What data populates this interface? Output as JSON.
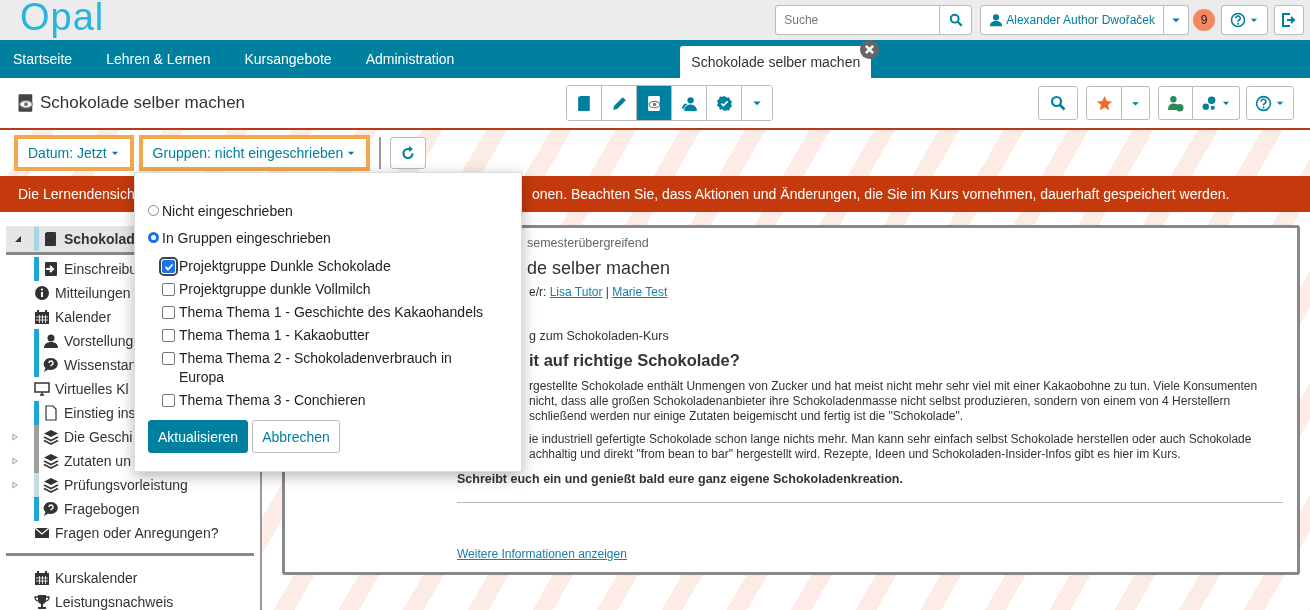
{
  "header": {
    "logo": "Opal",
    "search": {
      "placeholder": "Suche"
    },
    "user": "Alexander Author Dwořaček",
    "notifications": "9"
  },
  "nav": {
    "items": [
      {
        "label": "Startseite",
        "selected": false
      },
      {
        "label": "Lehren & Lernen",
        "selected": false
      },
      {
        "label": "Kursangebote",
        "selected": false
      },
      {
        "label": "Administration",
        "selected": false
      },
      {
        "label": "Schokolade selber machen",
        "selected": true
      }
    ]
  },
  "course": {
    "title": "Schokolade selber machen",
    "views": [
      {
        "kind": "book",
        "selected": false
      },
      {
        "kind": "pencil",
        "selected": false
      },
      {
        "kind": "eye-book",
        "selected": true
      },
      {
        "kind": "people",
        "selected": false
      },
      {
        "kind": "badge",
        "selected": false
      }
    ]
  },
  "filters": [
    {
      "label": "Datum: Jetzt"
    },
    {
      "label": "Gruppen: nicht eingeschrieben"
    }
  ],
  "banner": {
    "before": "Die Lernendensich",
    "after": "onen. Beachten Sie, dass Aktionen und Änderungen, die Sie im Kurs vornehmen, dauerhaft gespeichert werden."
  },
  "sidebar": {
    "items": [
      {
        "label": "Schokolad",
        "kind": "book",
        "selected": true,
        "expanded": true,
        "color": "#a9d4e4"
      },
      {
        "label": "Einschreibu",
        "kind": "enter",
        "selected": false,
        "color": "#1ba7d6"
      },
      {
        "label": "Mitteilungen",
        "kind": "info",
        "selected": false
      },
      {
        "label": "Kalender",
        "kind": "calendar",
        "selected": false
      },
      {
        "label": "Vorstellung",
        "kind": "person",
        "selected": false,
        "color": "#1ba7d6"
      },
      {
        "label": "Wissenstan",
        "kind": "question",
        "selected": false,
        "color": "#1ba7d6"
      },
      {
        "label": "Virtuelles Kl",
        "kind": "monitor",
        "selected": false
      },
      {
        "label": "Einstieg ins",
        "kind": "page",
        "selected": false,
        "color": "#1ba7d6"
      },
      {
        "label": "Die Geschi",
        "kind": "layers",
        "selected": false,
        "expanded": false,
        "color": "#9e9e9e"
      },
      {
        "label": "Zutaten un",
        "kind": "layers",
        "selected": false,
        "expanded": false,
        "color": "#9e9e9e"
      },
      {
        "label": "Prüfungsvorleistung",
        "kind": "layers",
        "selected": false,
        "expanded": false,
        "color": "#c6dce4"
      },
      {
        "label": "Fragebogen",
        "kind": "question",
        "selected": false,
        "color": "#1ba7d6"
      },
      {
        "label": "Fragen oder Anregungen?",
        "kind": "envelope",
        "selected": false
      }
    ],
    "footer_items": [
      {
        "label": "Kurskalender",
        "kind": "calendar"
      },
      {
        "label": "Leistungsnachweis",
        "kind": "trophy"
      }
    ]
  },
  "card": {
    "tag": "semesterübergreifend",
    "title": "de selber machen",
    "tutors_prefix": "e/r:",
    "tutors": [
      "Lisa Tutor",
      "Marie Test"
    ],
    "separator": "|",
    "subtitle": "g zum Schokoladen-Kurs",
    "heading": "it auf richtige Schokolade?",
    "paragraphs": [
      [
        "rgestellte Schokolade enthält Unmengen von Zucker und hat meist nicht mehr sehr viel mit einer Kakaobohne zu tun. Viele Konsumenten",
        "nicht, dass alle großen Schokoladenanbieter ihre Schokoladenmasse nicht selbst produzieren, sondern von einem von 4 Herstellern",
        "schließend werden nur einige Zutaten beigemischt und fertig ist die \"Schokolade\"."
      ],
      [
        "ie industriell gefertigte Schokolade schon lange nichts mehr. Man kann sehr einfach selbst Schokolade herstellen oder auch Schokolade",
        "achhaltig und direkt \"from bean to bar\" hergestellt wird. Rezepte, Ideen und Schokoladen-Insider-Infos gibt es hier im Kurs."
      ]
    ],
    "closing": "Schreibt euch ein und genießt bald eure ganz eigene Schokoladenkreation.",
    "more_link": "Weitere Informationen anzeigen"
  },
  "popup": {
    "options": [
      {
        "label": "Nicht eingeschrieben",
        "selected": false
      },
      {
        "label": "In Gruppen eingeschrieben",
        "selected": true
      }
    ],
    "groups": [
      {
        "label": "Projektgruppe Dunkle Schokolade",
        "checked": true
      },
      {
        "label": "Projektgruppe dunkle Vollmilch",
        "checked": false
      },
      {
        "label": "Thema Thema 1 - Geschichte des Kakaohandels",
        "checked": false
      },
      {
        "label": "Thema Thema 1 - Kakaobutter",
        "checked": false
      },
      {
        "label": "Thema Thema 2 - Schokoladenverbrauch in Europa",
        "checked": false
      },
      {
        "label": "Thema Thema 3 - Conchieren",
        "checked": false
      }
    ],
    "buttons": [
      "Aktualisieren",
      "Abbrechen"
    ]
  }
}
